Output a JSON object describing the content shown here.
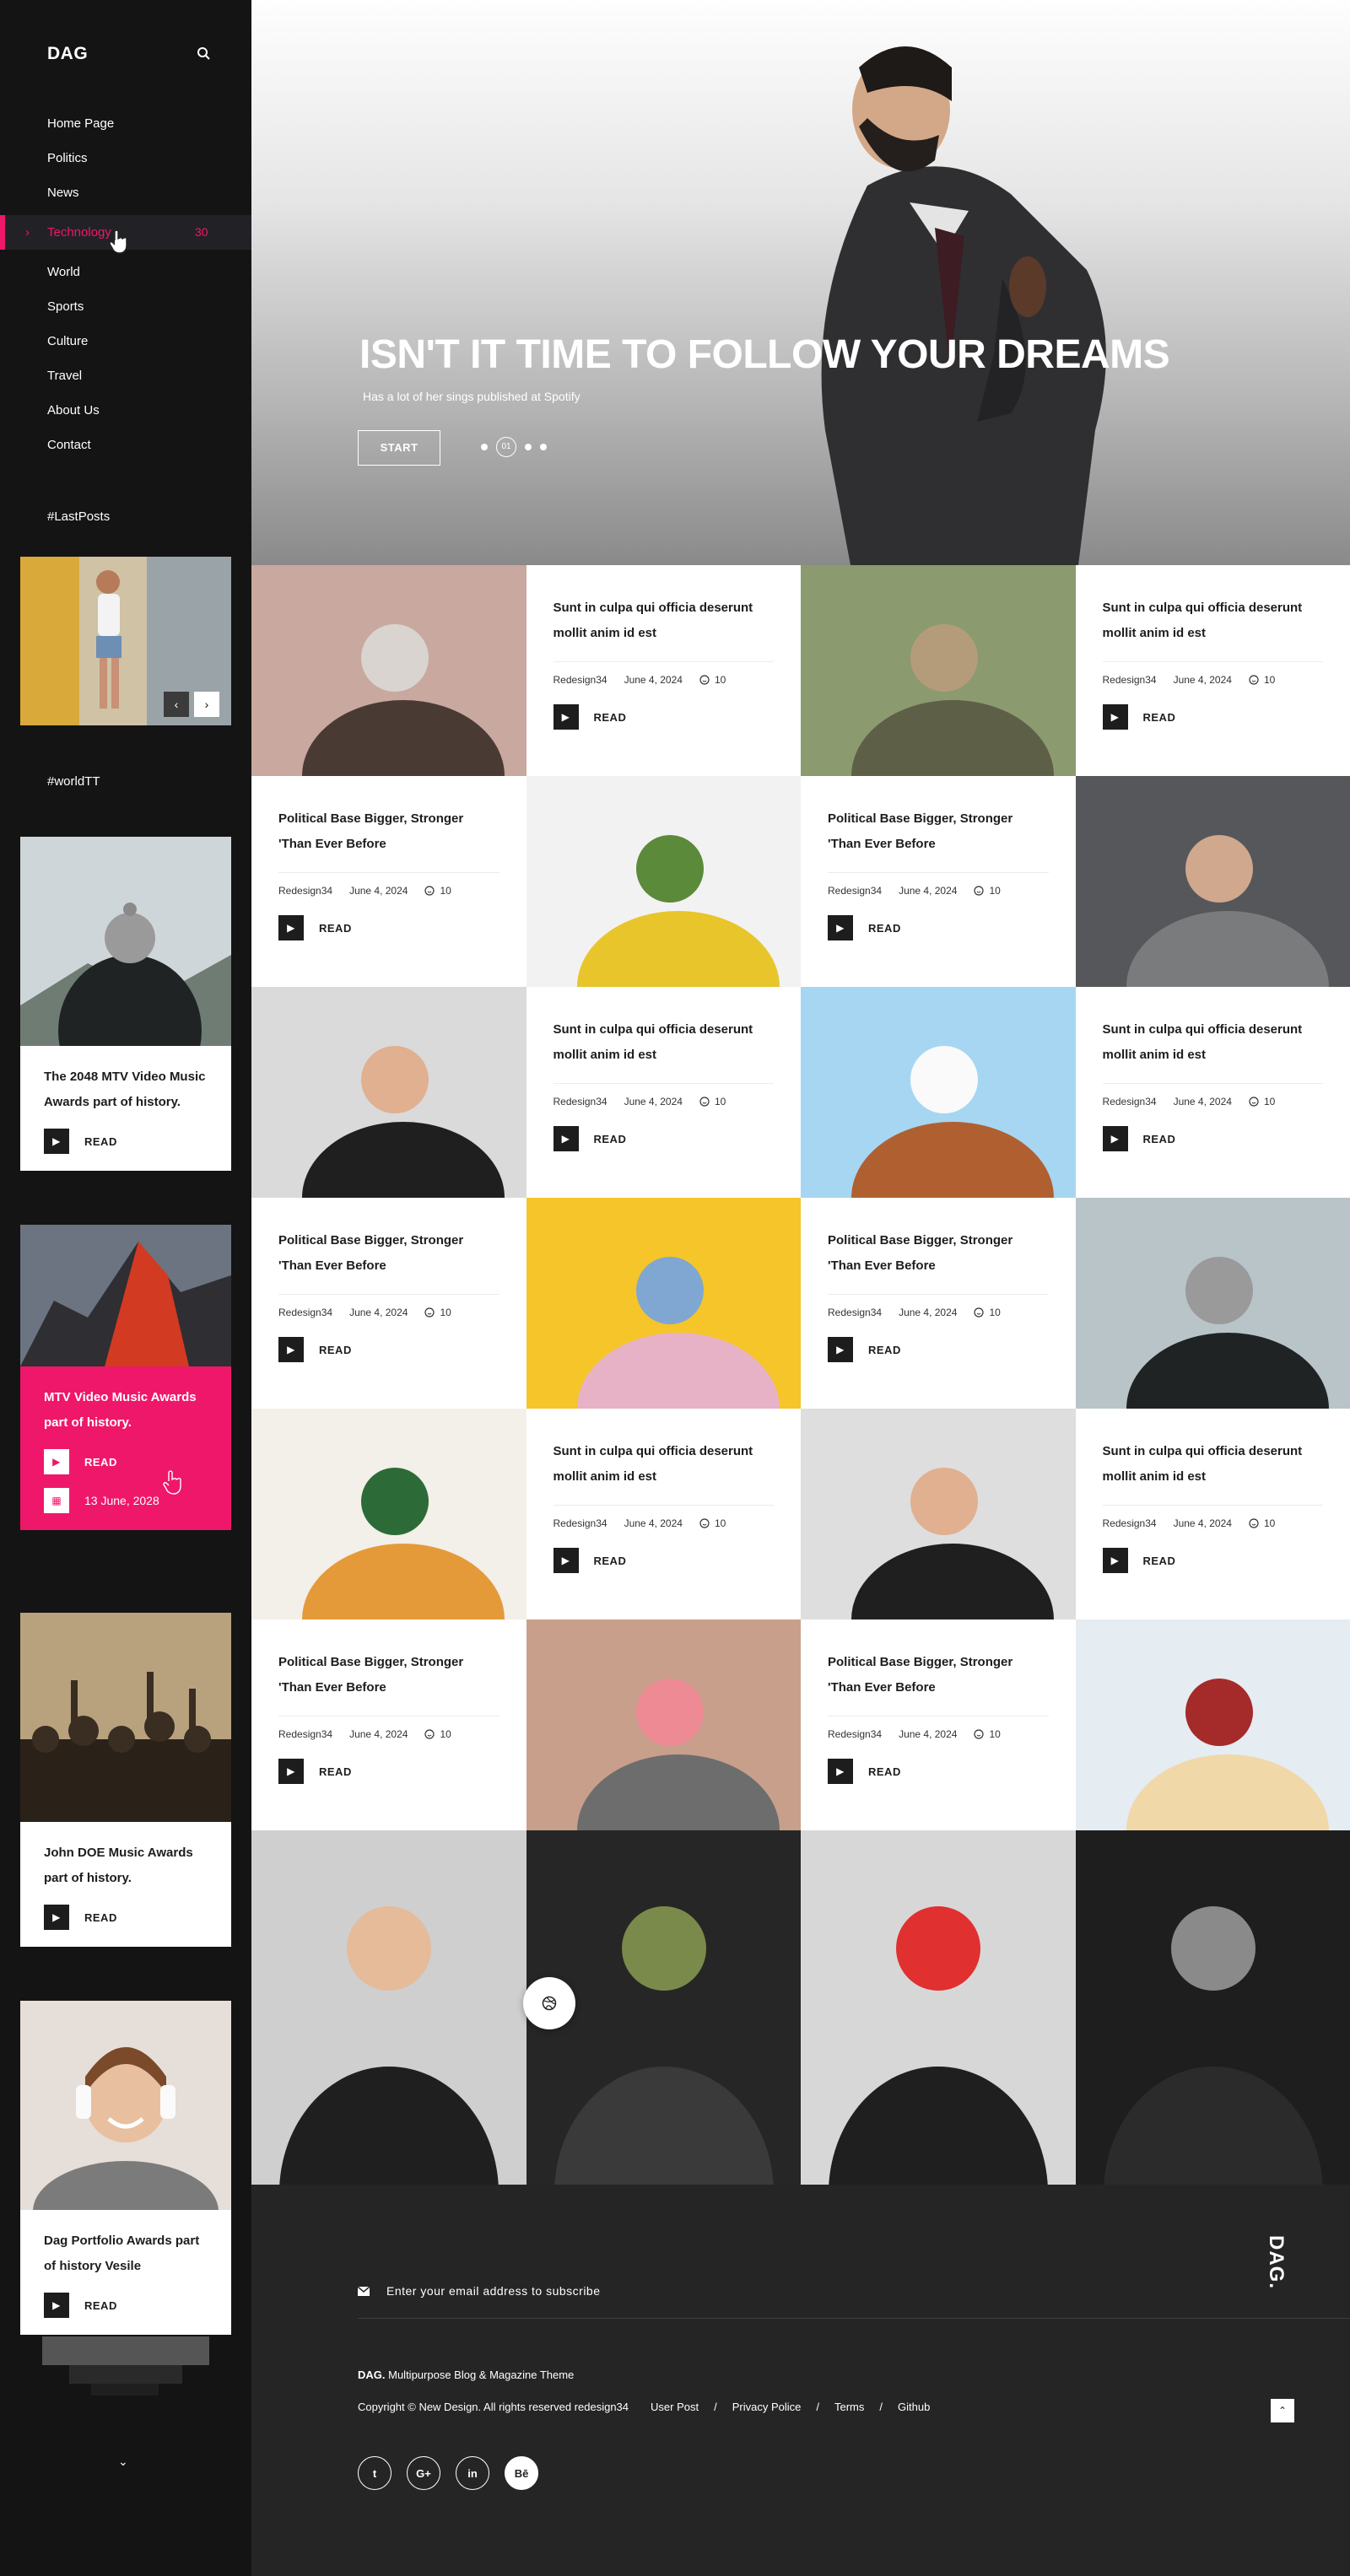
{
  "sidebar": {
    "logo": "DAG",
    "nav": [
      {
        "label": "Home Page"
      },
      {
        "label": "Politics"
      },
      {
        "label": "News"
      },
      {
        "label": "Technology",
        "count": "30",
        "active": true
      },
      {
        "label": "World"
      },
      {
        "label": "Sports"
      },
      {
        "label": "Culture"
      },
      {
        "label": "Travel"
      },
      {
        "label": "About Us"
      },
      {
        "label": "Contact"
      }
    ],
    "last_posts_heading": "#LastPosts",
    "world_heading": "#worldTT",
    "cards": [
      {
        "title": "The 2048 MTV Video Music Awards part of history.",
        "read": "READ"
      },
      {
        "title": "MTV Video Music Awards part of history.",
        "read": "READ",
        "date": "13 June, 2028"
      },
      {
        "title": "John DOE Music Awards part of history.",
        "read": "READ"
      },
      {
        "title": "Dag Portfolio Awards part of history Vesile",
        "read": "READ"
      }
    ]
  },
  "hero": {
    "title": "ISN'T IT TIME TO FOLLOW YOUR DREAMS",
    "subtitle": "Has a lot of her sings published at Spotify",
    "button": "START",
    "active_slide": "01"
  },
  "posts": {
    "title_a": "Sunt in culpa qui officia deserunt mollit anim id est",
    "title_b": "Political Base Bigger, Stronger 'Than Ever Before",
    "author": "Redesign34",
    "date": "June 4, 2024",
    "comments": "10",
    "read": "READ"
  },
  "footer": {
    "logo": "DAG.",
    "subscribe_placeholder": "Enter your email address to subscribe",
    "tag_brand": "DAG.",
    "tag_text": "Multipurpose Blog & Magazine Theme",
    "copyright": "Copyright © New Design. All rights reserved redesign34",
    "links": [
      "User Post",
      "/",
      "Privacy Police",
      "/",
      "Terms",
      "/",
      "Github"
    ],
    "socials": [
      "twitter-icon",
      "google-plus-icon",
      "linkedin-icon",
      "behance-icon"
    ]
  },
  "colors": {
    "accent": "#ef1769",
    "sidebar_bg": "#141414",
    "footer_bg": "#252525"
  }
}
